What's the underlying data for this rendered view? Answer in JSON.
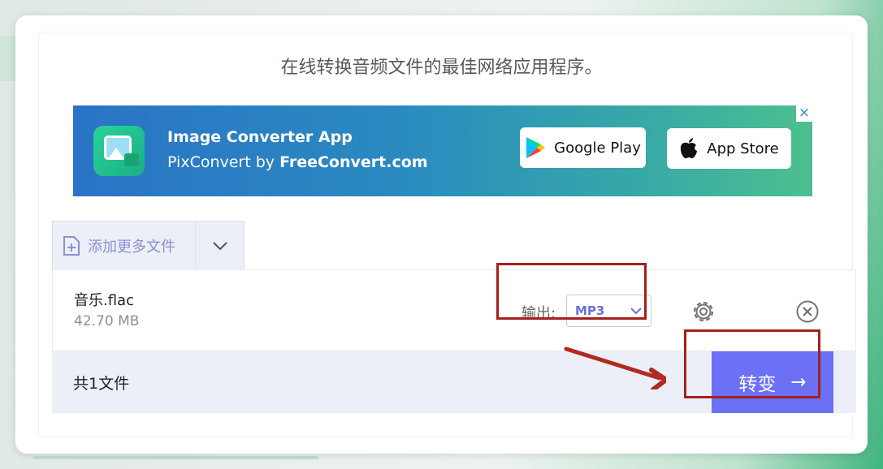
{
  "subtitle": "在线转换音频文件的最佳网络应用程序。",
  "banner": {
    "title": "Image Converter App",
    "subtitle_prefix": "PixConvert by ",
    "subtitle_brand": "FreeConvert.com",
    "close_glyph": "×",
    "google_play_label": "Google Play",
    "app_store_label": "App Store"
  },
  "upload": {
    "add_more_label": "添加更多文件"
  },
  "file": {
    "name": "音乐.flac",
    "size": "42.70 MB",
    "output_label": "输出:",
    "format": "MP3"
  },
  "footer": {
    "file_count": "共1文件",
    "convert_label": "转变",
    "convert_arrow": "→"
  },
  "colors": {
    "accent": "#6c70f5",
    "annotation": "#a4201c",
    "banner_start": "#2a73c6",
    "banner_end": "#4cc08e"
  },
  "icons": [
    "file-plus-icon",
    "chevron-down-icon",
    "gear-icon",
    "close-circle-icon",
    "google-play-icon",
    "apple-icon",
    "image-converter-app-icon"
  ]
}
